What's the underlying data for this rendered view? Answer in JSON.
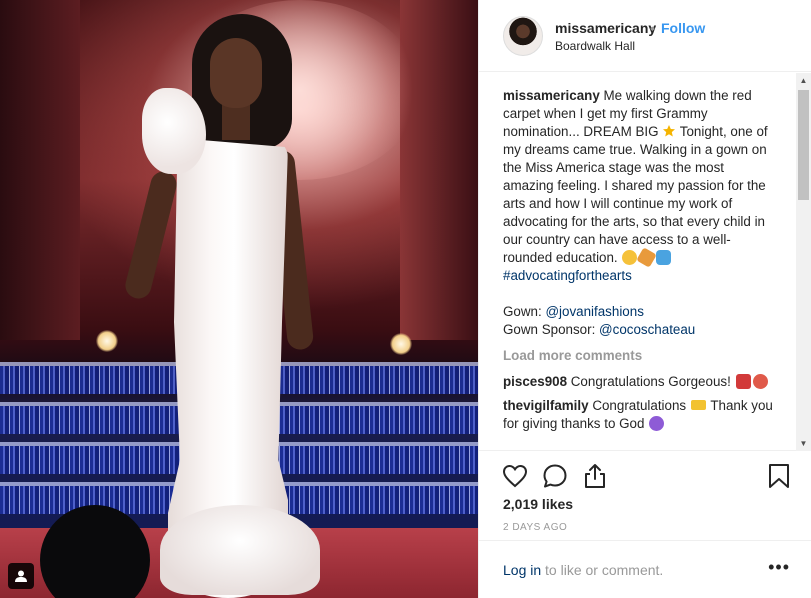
{
  "post": {
    "username": "missamericany",
    "separator": "•",
    "follow_label": "Follow",
    "location": "Boardwalk Hall"
  },
  "caption": {
    "username": "missamericany",
    "text_1": "Me walking down the red carpet when I get my first Grammy nomination... DREAM BIG",
    "text_2": "Tonight, one of my dreams came true. Walking in a gown on the Miss America stage was the most amazing feeling. I shared my passion for the arts and how I will continue my work of advocating for the arts, so that every child in our country can have access to a well-rounded education.",
    "hashtag": "#advocatingforthearts",
    "gown_label": "Gown:",
    "gown_mention": "@jovanifashions",
    "sponsor_label": "Gown Sponsor:",
    "sponsor_mention": "@cocoschateau"
  },
  "load_more_label": "Load more comments",
  "comments": [
    {
      "username": "pisces908",
      "text": "Congratulations Gorgeous!"
    },
    {
      "username": "thevigilfamily",
      "text_1": "Congratulations",
      "text_2": "Thank you for giving thanks to God"
    }
  ],
  "likes_label": "2,019 likes",
  "timestamp": "2 DAYS AGO",
  "footer": {
    "login_label": "Log in",
    "login_suffix": " to like or comment.",
    "more_label": "•••"
  },
  "icons": {
    "like": "heart-outline-icon",
    "comment": "speech-bubble-icon",
    "share": "share-upload-icon",
    "save": "bookmark-icon",
    "user_tag": "person-tag-icon",
    "star": "star-emoji-icon"
  },
  "colors": {
    "link_blue": "#3897f0",
    "dark_link": "#003569",
    "muted": "#999999",
    "text": "#262626"
  }
}
